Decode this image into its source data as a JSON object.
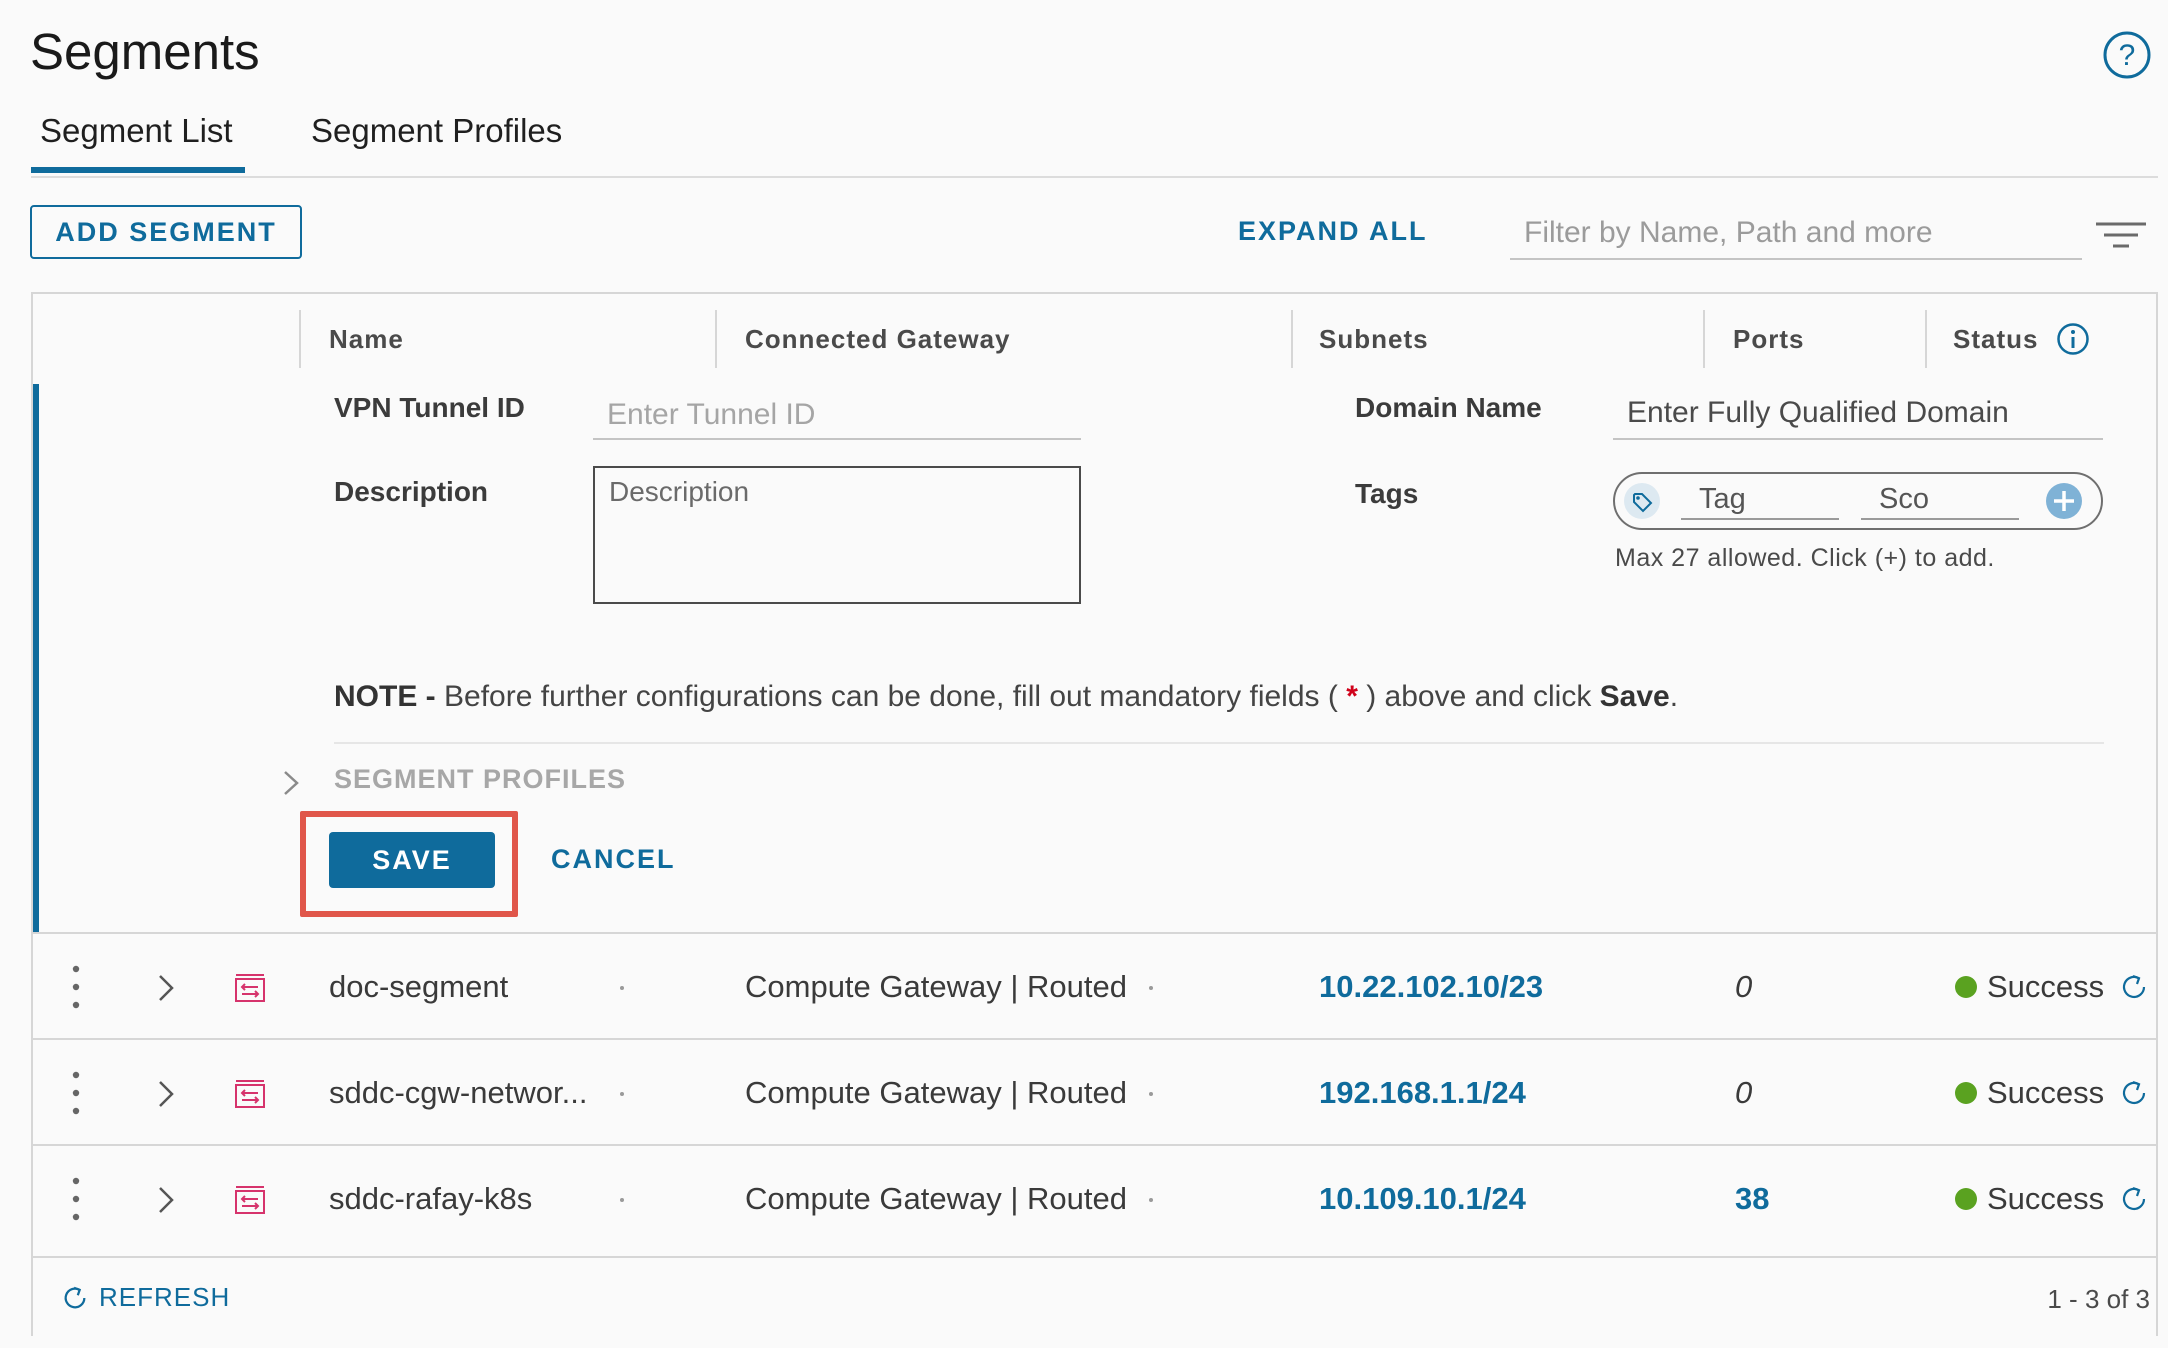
{
  "page": {
    "title": "Segments"
  },
  "tabs": [
    {
      "label": "Segment List",
      "active": true
    },
    {
      "label": "Segment Profiles",
      "active": false
    }
  ],
  "toolbar": {
    "add_label": "ADD SEGMENT",
    "expand_label": "EXPAND ALL",
    "filter_placeholder": "Filter by Name, Path and more"
  },
  "columns": [
    "Name",
    "Connected Gateway",
    "Subnets",
    "Ports",
    "Status"
  ],
  "edit": {
    "vpn_label": "VPN Tunnel ID",
    "vpn_placeholder": "Enter Tunnel ID",
    "domain_label": "Domain Name",
    "domain_placeholder": "Enter Fully Qualified Domain",
    "description_label": "Description",
    "description_placeholder": "Description",
    "tags_label": "Tags",
    "tag_placeholder": "Tag",
    "scope_placeholder": "Sco",
    "tags_help": "Max 27 allowed. Click (+) to add.",
    "note_prefix": "NOTE -",
    "note_text": " Before further configurations can be done, fill out mandatory fields ( ",
    "note_star": "*",
    "note_mid": " ) above and click ",
    "note_save": "Save",
    "note_end": ".",
    "profiles_label": "SEGMENT PROFILES",
    "save_label": "SAVE",
    "cancel_label": "CANCEL"
  },
  "rows": [
    {
      "name": "doc-segment",
      "gateway": "Compute Gateway | Routed",
      "subnet": "10.22.102.10/23",
      "ports": "0",
      "status": "Success"
    },
    {
      "name": "sddc-cgw-networ...",
      "gateway": "Compute Gateway | Routed",
      "subnet": "192.168.1.1/24",
      "ports": "0",
      "status": "Success"
    },
    {
      "name": "sddc-rafay-k8s",
      "gateway": "Compute Gateway | Routed",
      "subnet": "10.109.10.1/24",
      "ports": "38",
      "status": "Success"
    }
  ],
  "footer": {
    "refresh_label": "REFRESH",
    "pagination": "1 - 3 of 3"
  },
  "colors": {
    "accent": "#0f6b9c",
    "success": "#5aa220",
    "highlight": "#e0564a",
    "segment_icon": "#d6336c"
  }
}
